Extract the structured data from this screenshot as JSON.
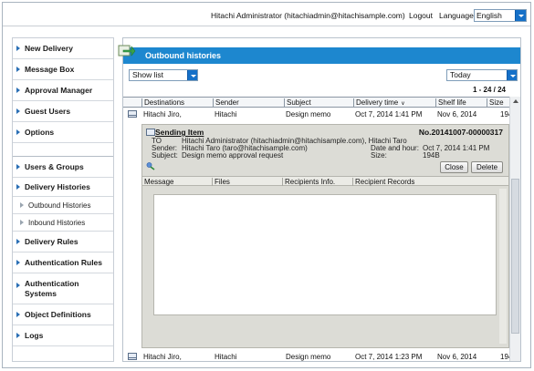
{
  "header": {
    "user": "Hitachi Administrator (hitachiadmin@hitachisample.com)",
    "logout": "Logout",
    "language_label": "Language",
    "language_value": "English"
  },
  "sidebar": {
    "items": [
      {
        "label": "New Delivery"
      },
      {
        "label": "Message Box"
      },
      {
        "label": "Approval Manager"
      },
      {
        "label": "Guest Users"
      },
      {
        "label": "Options"
      },
      {
        "label": "Users & Groups"
      },
      {
        "label": "Delivery Histories"
      },
      {
        "label": "Outbound Histories"
      },
      {
        "label": "Inbound Histories"
      },
      {
        "label": "Delivery Rules"
      },
      {
        "label": "Authentication Rules"
      },
      {
        "label": "Authentication Systems"
      },
      {
        "label": "Object Definitions"
      },
      {
        "label": "Logs"
      }
    ]
  },
  "main": {
    "title": "Outbound histories",
    "show_list": "Show list",
    "period": "Today",
    "pager": "1 - 24 / 24",
    "columns": [
      "Destinations",
      "Sender",
      "Subject",
      "Delivery time",
      "Shelf life",
      "Size"
    ],
    "sort_indicator": "∨",
    "rows": [
      {
        "destinations": "Hitachi Jiro,",
        "sender": "Hitachi",
        "subject": "Design memo",
        "delivery_time": "Oct 7, 2014 1:41 PM",
        "shelf_life": "Nov 6, 2014",
        "size": "194"
      },
      {
        "destinations": "Hitachi Jiro,",
        "sender": "Hitachi",
        "subject": "Design memo",
        "delivery_time": "Oct 7, 2014 1:23 PM",
        "shelf_life": "Nov 6, 2014",
        "size": "194"
      }
    ]
  },
  "detail": {
    "title": "Sending Item",
    "number": "No.20141007-00000317",
    "to_label": "TO",
    "to_value": "Hitachi Administrator (hitachiadmin@hitachisample.com), Hitachi Taro",
    "sender_label": "Sender:",
    "sender_value": "Hitachi Taro (taro@hitachisample.com)",
    "subject_label": "Subject:",
    "subject_value": "Design memo approval request",
    "date_label": "Date and hour:",
    "date_value": "Oct 7, 2014 1:41 PM",
    "size_label": "Size:",
    "size_value": "194B",
    "close": "Close",
    "delete": "Delete",
    "tabs": [
      "Message",
      "Files",
      "Recipients Info.",
      "Recipient Records"
    ]
  },
  "colors": {
    "accent": "#1d87cf",
    "menu_arrow": "#2a6fb5",
    "detail_bg": "#dcdcd6"
  }
}
